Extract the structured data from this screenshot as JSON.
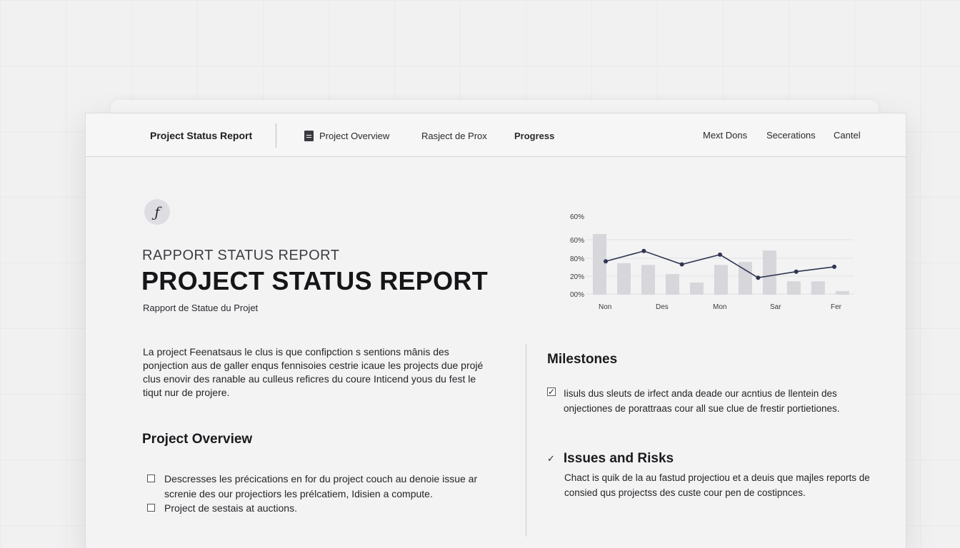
{
  "header": {
    "brand": "Project Status Report",
    "nav": [
      "Project Overview",
      "Rasject de Prox",
      "Progress"
    ],
    "right_links": [
      "Mext Dons",
      "Secerations",
      "Cantel"
    ]
  },
  "logo_glyph": "ƒ",
  "eyebrow": "RAPPORT STATUS REPORT",
  "title": "PROJECT STATUS REPORT",
  "subtitle": "Rapport de Statue du Projet",
  "intro": "La project Feenatsaus le clus is que confipction s sentions mânis des ponjection aus de galler enqus fennisoies cestrie icaue les projects due projé clus enovir des ranable au culleus reficres du coure Inticend yous du fest le tiqut nur de projere.",
  "overview": {
    "heading": "Project Overview",
    "items": [
      "Descresses les précications en for du project couch au denoie issue ar screnie des our projectiors les prélcatiem, Idisien a compute.",
      "Project de sestais at auctions."
    ]
  },
  "milestones": {
    "heading": "Milestones",
    "tick": "✓",
    "item": "Iisuls dus sleuts de irfect anda deade our acntius de llentein des onjectiones de porattraas cour all sue clue de frestir portietiones."
  },
  "issues": {
    "tick": "✓",
    "heading": "Issues and Risks",
    "text": "Chact is quik de la au fastud projectiou et a deuis que majles reports de consied qus projectss des custe cour pen de costipnces."
  },
  "chart_data": {
    "type": "bar",
    "y_tick_labels": [
      "60%",
      "60%",
      "80%",
      "20%",
      "00%"
    ],
    "x_tick_labels": [
      "Non",
      "Des",
      "Mon",
      "Sar",
      "Fer"
    ],
    "bar_values": [
      1.0,
      0.52,
      0.49,
      0.34,
      0.2,
      0.49,
      0.54,
      0.73,
      0.22,
      0.22,
      0.06
    ],
    "line_values": [
      0.55,
      0.72,
      0.5,
      0.66,
      0.28,
      0.38,
      0.46
    ],
    "ylim": [
      0,
      1.2
    ],
    "colors": {
      "bar": "#d6d6db",
      "line": "#2f3552"
    }
  }
}
